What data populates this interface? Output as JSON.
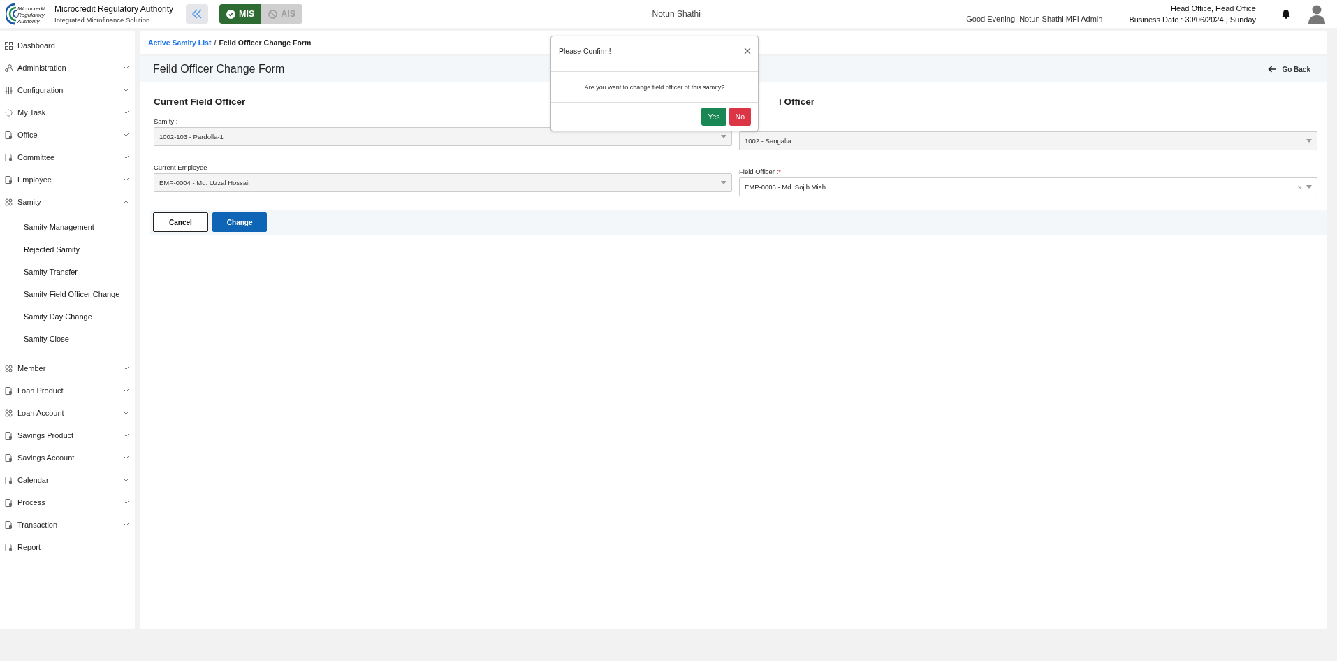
{
  "header": {
    "logo_lines": [
      "Microcredit",
      "Regulatory",
      "Authority"
    ],
    "title": "Microcredit Regulatory Authority",
    "subtitle": "Integrated Microfinance Solution",
    "modules": [
      {
        "label": "MIS",
        "selected": true
      },
      {
        "label": "AIS",
        "selected": false
      }
    ],
    "organization": "Notun Shathi",
    "greeting": "Good Evening, Notun Shathi MFI Admin",
    "office": "Head Office, Head Office",
    "business_date": "Business Date : 30/06/2024 , Sunday"
  },
  "sidebar": {
    "items": [
      {
        "label": "Dashboard",
        "kind": "grid"
      },
      {
        "label": "Administration",
        "kind": "users",
        "expanded": false
      },
      {
        "label": "Configuration",
        "kind": "sliders",
        "expanded": false
      },
      {
        "label": "My Task",
        "kind": "circle",
        "expanded": false
      },
      {
        "label": "Office",
        "kind": "doc",
        "expanded": false
      },
      {
        "label": "Committee",
        "kind": "doc",
        "expanded": false
      },
      {
        "label": "Employee",
        "kind": "doc",
        "expanded": false
      },
      {
        "label": "Samity",
        "kind": "group",
        "expanded": true,
        "children": [
          {
            "label": "Samity Management"
          },
          {
            "label": "Rejected Samity"
          },
          {
            "label": "Samity Transfer"
          },
          {
            "label": "Samity Field Officer Change"
          },
          {
            "label": "Samity Day Change"
          },
          {
            "label": "Samity Close"
          }
        ]
      },
      {
        "label": "Member",
        "kind": "group",
        "expanded": false
      },
      {
        "label": "Loan Product",
        "kind": "doc",
        "expanded": false
      },
      {
        "label": "Loan Account",
        "kind": "group",
        "expanded": false
      },
      {
        "label": "Savings Product",
        "kind": "doc",
        "expanded": false
      },
      {
        "label": "Savings Account",
        "kind": "doc",
        "expanded": false
      },
      {
        "label": "Calendar",
        "kind": "doc",
        "expanded": false
      },
      {
        "label": "Process",
        "kind": "doc",
        "expanded": false
      },
      {
        "label": "Transaction",
        "kind": "doc",
        "expanded": false
      },
      {
        "label": "Report",
        "kind": "doc"
      }
    ]
  },
  "breadcrumb": {
    "separator": "/",
    "items": [
      {
        "label": "Active Samity List",
        "link": true
      },
      {
        "label": "Feild Officer Change Form",
        "link": false
      }
    ]
  },
  "page_title": "Feild Officer Change Form",
  "go_back": "Go Back",
  "sections": [
    {
      "heading": "Current Field Officer",
      "fields": [
        {
          "label": "Samity :",
          "value": "1002-103 - Pardolla-1",
          "disabled": true
        },
        {
          "label": "Current Employee :",
          "value": "EMP-0004 - Md. Uzzal Hossain",
          "disabled": true
        }
      ]
    },
    {
      "heading": "l Officer",
      "fields": [
        {
          "value": "1002 - Sangalia",
          "disabled": true
        },
        {
          "label": "Field Officer :",
          "required_mark": "*",
          "value": "EMP-0005 - Md. Sojib Miah",
          "disabled": false,
          "clearable": "×"
        }
      ]
    }
  ],
  "actions": [
    {
      "label": "Cancel",
      "kind": "outline"
    },
    {
      "label": "Change",
      "kind": "primary"
    }
  ],
  "modal": {
    "title": "Please Confirm!",
    "message": "Are you want to change field officer of this samity?",
    "buttons": [
      {
        "label": "Yes",
        "kind": "success"
      },
      {
        "label": "No",
        "kind": "danger"
      }
    ]
  }
}
